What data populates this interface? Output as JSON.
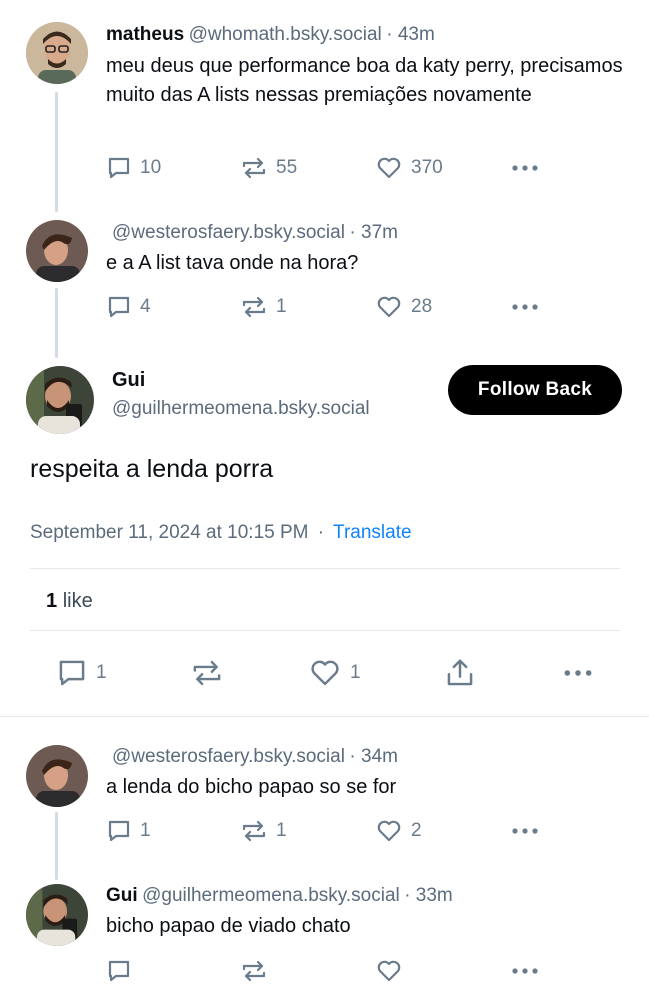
{
  "posts": [
    {
      "name": "matheus",
      "handle": "@whomath.bsky.social",
      "time": "· 43m",
      "text": "meu deus que performance boa da katy perry, precisamos muito das A lists nessas premiações novamente",
      "replies": "10",
      "reposts": "55",
      "likes": "370"
    },
    {
      "name": "",
      "handle": "@westerosfaery.bsky.social",
      "time": "· 37m",
      "text": "e a A list tava onde na hora?",
      "replies": "4",
      "reposts": "1",
      "likes": "28"
    }
  ],
  "main": {
    "name": "Gui",
    "handle": "@guilhermeomena.bsky.social",
    "follow_label": "Follow Back",
    "text": "respeita a lenda porra",
    "date": "September 11, 2024 at 10:15 PM",
    "separator": "·",
    "translate": "Translate",
    "like_count": "1",
    "like_word": "like",
    "replies": "1",
    "likes": "1"
  },
  "replies": [
    {
      "name": "",
      "handle": "@westerosfaery.bsky.social",
      "time": "· 34m",
      "text": "a lenda do bicho papao so se for",
      "replies": "1",
      "reposts": "1",
      "likes": "2"
    },
    {
      "name": "Gui",
      "handle": "@guilhermeomena.bsky.social",
      "time": "· 33m",
      "text": "bicho papao de viado chato",
      "replies": "",
      "reposts": "",
      "likes": ""
    }
  ],
  "colors": {
    "text": "#0b0f14",
    "muted": "#5b6b7c",
    "link": "#1083fe",
    "button": "#000000"
  }
}
